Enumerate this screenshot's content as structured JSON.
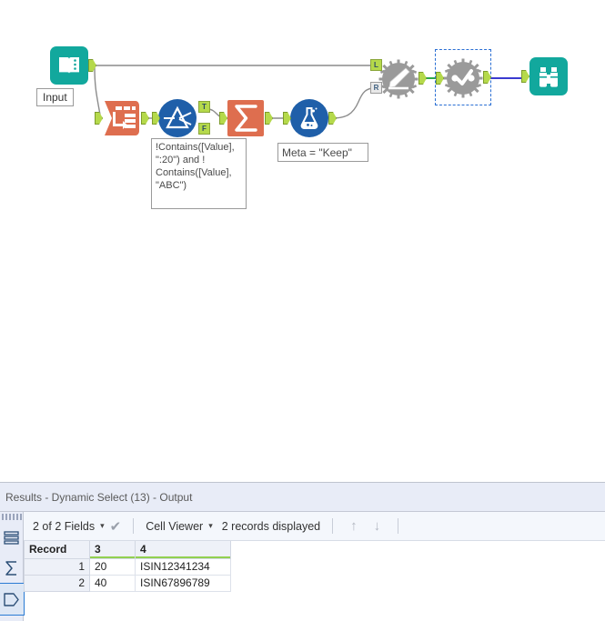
{
  "canvas": {
    "tools": [
      {
        "id": "input",
        "name": "Input Data",
        "icon": "book-icon",
        "color": "#12a89d",
        "label": "Input"
      },
      {
        "id": "text-to-columns",
        "name": "Text To Columns",
        "icon": "record-split-icon",
        "color": "#de6e4f",
        "label": ""
      },
      {
        "id": "filter",
        "name": "Filter",
        "icon": "prism-icon",
        "color": "#1f5fa9",
        "label": "",
        "out_true": "T",
        "out_false": "F"
      },
      {
        "id": "summarize",
        "name": "Summarize",
        "icon": "sigma-icon",
        "color": "#de6e4f",
        "label": ""
      },
      {
        "id": "field-info",
        "name": "Field Info",
        "icon": "flask-icon",
        "color": "#1f5fa9",
        "label": ""
      },
      {
        "id": "dynamic-rename",
        "name": "Dynamic Rename",
        "icon": "gear-pencil-icon",
        "color": "#9a9a9a",
        "label": "",
        "in_left": "L",
        "in_right": "R"
      },
      {
        "id": "dynamic-select",
        "name": "Dynamic Select",
        "icon": "gear-check-icon",
        "color": "#9a9a9a",
        "label": "",
        "selected": true
      },
      {
        "id": "browse",
        "name": "Browse",
        "icon": "binoculars-icon",
        "color": "#12a89d",
        "label": ""
      }
    ],
    "annotations": {
      "filter_expression": "!Contains([Value],\n\":20\") and !\nContains([Value],\n\"ABC\")",
      "field_info_note": "Meta = \"Keep\""
    },
    "colors": {
      "teal": "#12a89d",
      "orange": "#de6e4f",
      "blue": "#1f5fa9",
      "gray_tool": "#9a9a9a",
      "anchor_green": "#b5d94b",
      "wire_gray": "#8c8c8c",
      "wire_green": "#2aa84a",
      "wire_blue": "#3a3ad0",
      "selection_blue": "#2a6fd4"
    }
  },
  "results": {
    "title": "Results - Dynamic Select (13) - Output",
    "rail": [
      {
        "name": "messages-icon",
        "glyph": "☰",
        "selected": false
      },
      {
        "name": "sigma-icon",
        "glyph": "Σ",
        "selected": false
      },
      {
        "name": "data-tag-icon",
        "glyph": "⬠",
        "selected": true
      }
    ],
    "toolbar": {
      "fields_label": "2 of 2 Fields",
      "fields_caret": "▾",
      "check_glyph": "✔",
      "viewer_label": "Cell Viewer",
      "viewer_caret": "▾",
      "records_label": "2 records displayed",
      "up_arrow": "↑",
      "down_arrow": "↓"
    },
    "table": {
      "columns": [
        "Record",
        "3",
        "4"
      ],
      "rows": [
        {
          "record": "1",
          "c3": "20",
          "c4": "ISIN12341234"
        },
        {
          "record": "2",
          "c3": "40",
          "c4": "ISIN67896789"
        }
      ]
    }
  }
}
